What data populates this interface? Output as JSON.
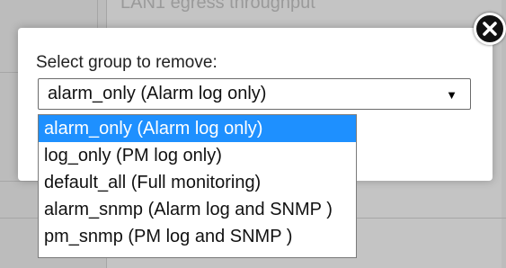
{
  "background": {
    "header_text": "LAN1 egress throughput"
  },
  "dialog": {
    "prompt": "Select group to remove:",
    "select": {
      "value": "alarm_only (Alarm log only)"
    },
    "options": [
      {
        "label": "alarm_only (Alarm log only)",
        "selected": true
      },
      {
        "label": "log_only (PM log only)",
        "selected": false
      },
      {
        "label": "default_all (Full monitoring)",
        "selected": false
      },
      {
        "label": "alarm_snmp (Alarm log and SNMP )",
        "selected": false
      },
      {
        "label": "pm_snmp (PM log and SNMP )",
        "selected": false
      }
    ]
  },
  "icons": {
    "close": "close-icon",
    "dropdown": "triangle-down-icon"
  },
  "colors": {
    "highlight": "#1e90ff",
    "overlay": "#bcbcbc"
  }
}
